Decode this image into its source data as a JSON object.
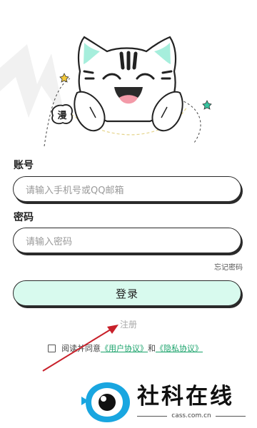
{
  "hero": {
    "badge_char": "漫"
  },
  "form": {
    "account_label": "账号",
    "account_placeholder": "请输入手机号或QQ邮箱",
    "password_label": "密码",
    "password_placeholder": "请输入密码",
    "forgot_password": "忘记密码",
    "login_button": "登录",
    "register_link": "注册"
  },
  "agreement": {
    "prefix": "阅读并同意",
    "user_agreement": "《用户协议》",
    "and": "和",
    "privacy_policy": "《隐私协议》"
  },
  "watermark": {
    "title": "社科在线",
    "url": "cass.com.cn"
  },
  "colors": {
    "accent_green": "#1aa36b",
    "button_fill": "#d8faee",
    "arrow_red": "#c8202a",
    "logo_blue": "#19a6e0"
  }
}
